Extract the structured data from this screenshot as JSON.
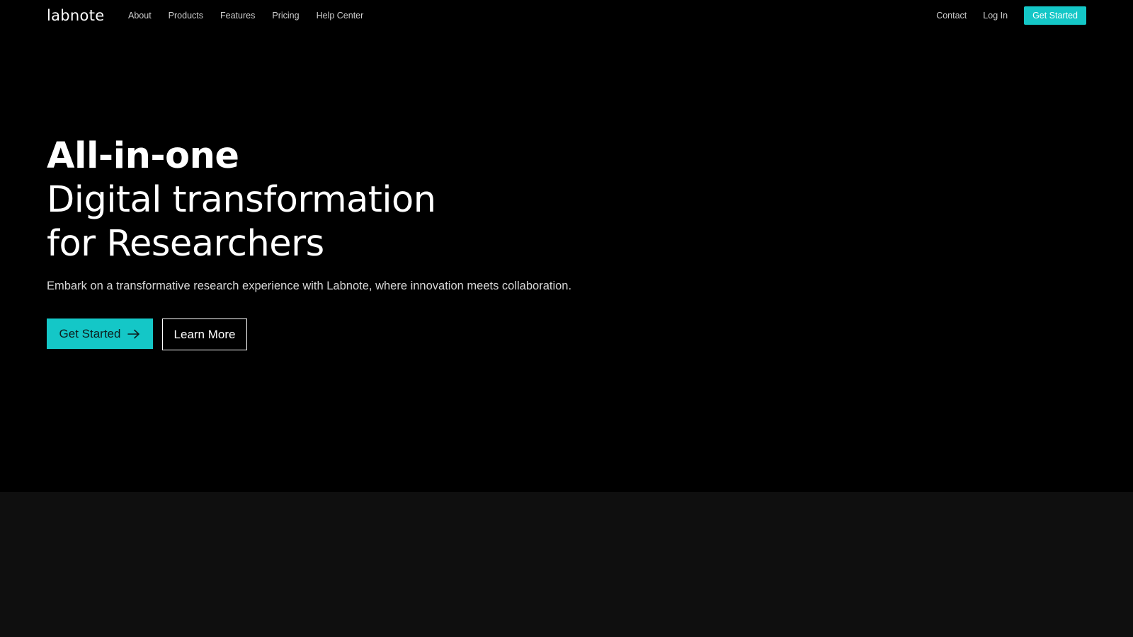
{
  "nav": {
    "logo": "labnote",
    "links_left": [
      "About",
      "Products",
      "Features",
      "Pricing",
      "Help Center"
    ],
    "contact": "Contact",
    "login": "Log In",
    "cta": "Get Started"
  },
  "hero": {
    "headline_line1": "All-in-one",
    "headline_line2": "Digital transformation",
    "headline_line3": "for Researchers",
    "subtitle": "Embark on a transformative research experience with Labnote, where innovation meets collaboration.",
    "primary_button": "Get Started",
    "secondary_button": "Learn More"
  },
  "icons": {
    "primary_button_icon": "arrow-right-icon"
  },
  "colors": {
    "accent": "#14c7c7",
    "background": "#000000",
    "lower_section": "#0f0f0f"
  }
}
